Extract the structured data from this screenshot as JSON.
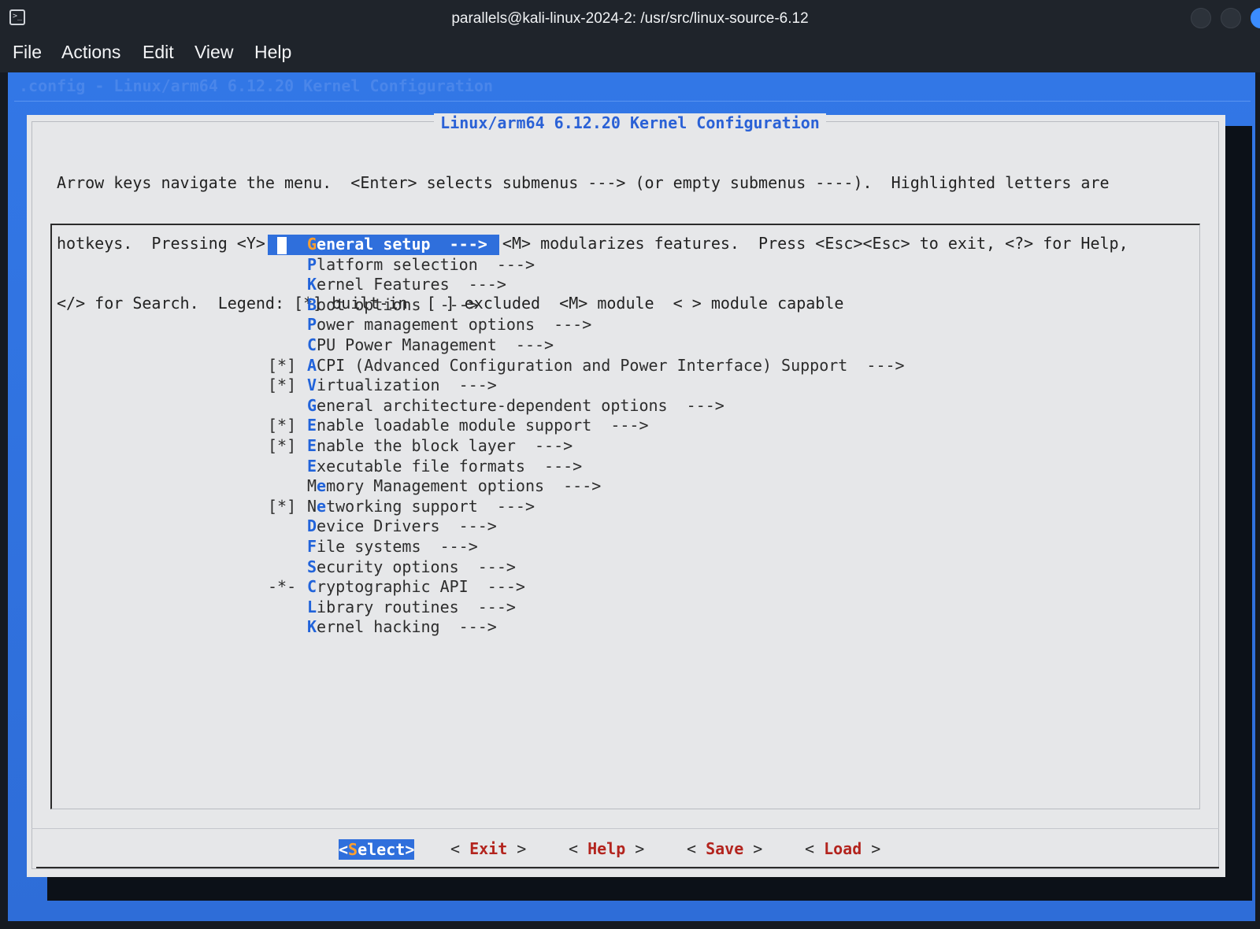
{
  "window": {
    "title": "parallels@kali-linux-2024-2: /usr/src/linux-source-6.12",
    "icon": "terminal-icon"
  },
  "menubar": [
    "File",
    "Actions",
    "Edit",
    "View",
    "Help"
  ],
  "terminal": {
    "header": ".config - Linux/arm64 6.12.20 Kernel Configuration"
  },
  "dialog": {
    "title": "Linux/arm64 6.12.20 Kernel Configuration",
    "help_lines": [
      "Arrow keys navigate the menu.  <Enter> selects submenus ---> (or empty submenus ----).  Highlighted letters are",
      "hotkeys.  Pressing <Y> includes, <N> excludes, <M> modularizes features.  Press <Esc><Esc> to exit, <?> for Help,",
      "</> for Search.  Legend: [*] built-in  [ ] excluded  <M> module  < > module capable"
    ],
    "items": [
      {
        "prefix": "",
        "hot": "G",
        "rest": "eneral setup",
        "arrow": "  --->",
        "selected": true
      },
      {
        "prefix": "",
        "hot": "P",
        "rest": "latform selection",
        "arrow": "  --->",
        "selected": false
      },
      {
        "prefix": "",
        "hot": "K",
        "rest": "ernel Features",
        "arrow": "  --->",
        "selected": false
      },
      {
        "prefix": "",
        "hot": "B",
        "rest": "oot options",
        "arrow": "  --->",
        "selected": false
      },
      {
        "prefix": "",
        "hot": "P",
        "rest": "ower management options",
        "arrow": "  --->",
        "selected": false
      },
      {
        "prefix": "",
        "hot": "C",
        "rest": "PU Power Management",
        "arrow": "  --->",
        "selected": false
      },
      {
        "prefix": "[*]",
        "hot": "A",
        "rest": "CPI (Advanced Configuration and Power Interface) Support",
        "arrow": "  --->",
        "selected": false
      },
      {
        "prefix": "[*]",
        "hot": "V",
        "rest": "irtualization",
        "arrow": "  --->",
        "selected": false
      },
      {
        "prefix": "",
        "hot": "G",
        "rest": "eneral architecture-dependent options",
        "arrow": "  --->",
        "selected": false
      },
      {
        "prefix": "[*]",
        "hot": "E",
        "rest": "nable loadable module support",
        "arrow": "  --->",
        "selected": false
      },
      {
        "prefix": "[*]",
        "hot": "E",
        "rest": "nable the block layer",
        "arrow": "  --->",
        "selected": false
      },
      {
        "prefix": "",
        "hot": "E",
        "rest": "xecutable file formats",
        "arrow": "  --->",
        "selected": false
      },
      {
        "prefix": "",
        "hot": "",
        "pre": "M",
        "hot2": "e",
        "rest": "mory Management options",
        "arrow": "  --->",
        "selected": false
      },
      {
        "prefix": "[*]",
        "hot": "",
        "pre": "N",
        "hot2": "e",
        "rest": "tworking support",
        "arrow": "  --->",
        "selected": false
      },
      {
        "prefix": "",
        "hot": "D",
        "rest": "evice Drivers",
        "arrow": "  --->",
        "selected": false
      },
      {
        "prefix": "",
        "hot": "F",
        "rest": "ile systems",
        "arrow": "  --->",
        "selected": false
      },
      {
        "prefix": "",
        "hot": "S",
        "rest": "ecurity options",
        "arrow": "  --->",
        "selected": false
      },
      {
        "prefix": "-*-",
        "hot": "C",
        "rest": "ryptographic API",
        "arrow": "  --->",
        "selected": false
      },
      {
        "prefix": "",
        "hot": "L",
        "rest": "ibrary routines",
        "arrow": "  --->",
        "selected": false
      },
      {
        "prefix": "",
        "hot": "K",
        "rest": "ernel hacking",
        "arrow": "  --->",
        "selected": false
      }
    ],
    "buttons": [
      {
        "open": "<",
        "hot": "S",
        "rest": "elect",
        "close": ">",
        "selected": true
      },
      {
        "open": "< ",
        "hot": "E",
        "rest": "xit",
        "close": " >",
        "selected": false
      },
      {
        "open": "< ",
        "hot": "H",
        "rest": "elp",
        "close": " >",
        "selected": false
      },
      {
        "open": "< ",
        "hot": "S",
        "rest": "ave",
        "close": " >",
        "selected": false
      },
      {
        "open": "< ",
        "hot": "L",
        "rest": "oad",
        "close": " >",
        "selected": false
      }
    ]
  }
}
